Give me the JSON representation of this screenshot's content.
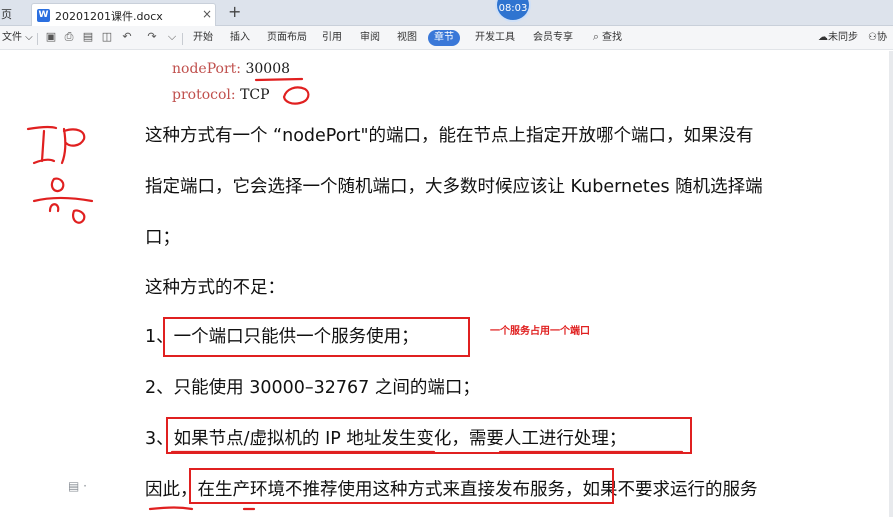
{
  "titlebar": {
    "home_tab": "页",
    "doc_icon": "W",
    "doc_title": "20201201课件.docx",
    "close": "×",
    "new_tab": "+",
    "clock": "08:03"
  },
  "ribbon": {
    "file": "文件 ⌵",
    "menus": [
      "开始",
      "插入",
      "页面布局",
      "引用",
      "审阅",
      "视图",
      "章节",
      "开发工具",
      "会员专享",
      "查找"
    ],
    "active_menu": "章节",
    "sync": "未同步",
    "collab": "协"
  },
  "document": {
    "code_lines": [
      {
        "key": "nodePort:",
        "value": "30008"
      },
      {
        "key": "protocol:",
        "value": "TCP"
      }
    ],
    "paragraphs": [
      "这种方式有一个 “nodePort\"的端口，能在节点上指定开放哪个端口，如果没有",
      "指定端口，它会选择一个随机端口，大多数时候应该让 Kubernetes 随机选择端",
      "口；",
      "这种方式的不足：",
      "1、一个端口只能供一个服务使用；",
      "2、只能使用 30000–32767 之间的端口；",
      "3、如果节点/虚拟机的 IP 地址发生变化，需要人工进行处理；",
      "因此，在生产环境不推荐使用这种方式来直接发布服务，如果不要求运行的服务"
    ],
    "annotation_note": "一个服务占用一个端口"
  },
  "colors": {
    "accent": "#3a78d8",
    "annotation": "#e02020",
    "code_key": "#c0504d"
  }
}
